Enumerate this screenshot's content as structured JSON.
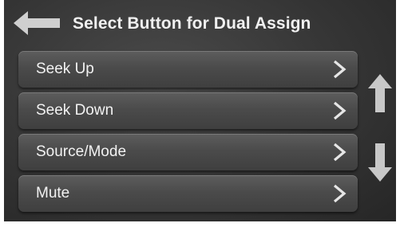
{
  "header": {
    "title": "Select Button for Dual Assign",
    "back_icon": "back-arrow-icon"
  },
  "list": {
    "items": [
      {
        "label": "Seek Up",
        "icon": "chevron-right-icon"
      },
      {
        "label": "Seek Down",
        "icon": "chevron-right-icon"
      },
      {
        "label": "Source/Mode",
        "icon": "chevron-right-icon"
      },
      {
        "label": "Mute",
        "icon": "chevron-right-icon"
      }
    ]
  },
  "scroll": {
    "up_icon": "arrow-up-icon",
    "down_icon": "arrow-down-icon"
  },
  "colors": {
    "background": "#353535",
    "button": "#4b4b4b",
    "text": "#f2f2f2",
    "icon": "#c8c8c8"
  }
}
